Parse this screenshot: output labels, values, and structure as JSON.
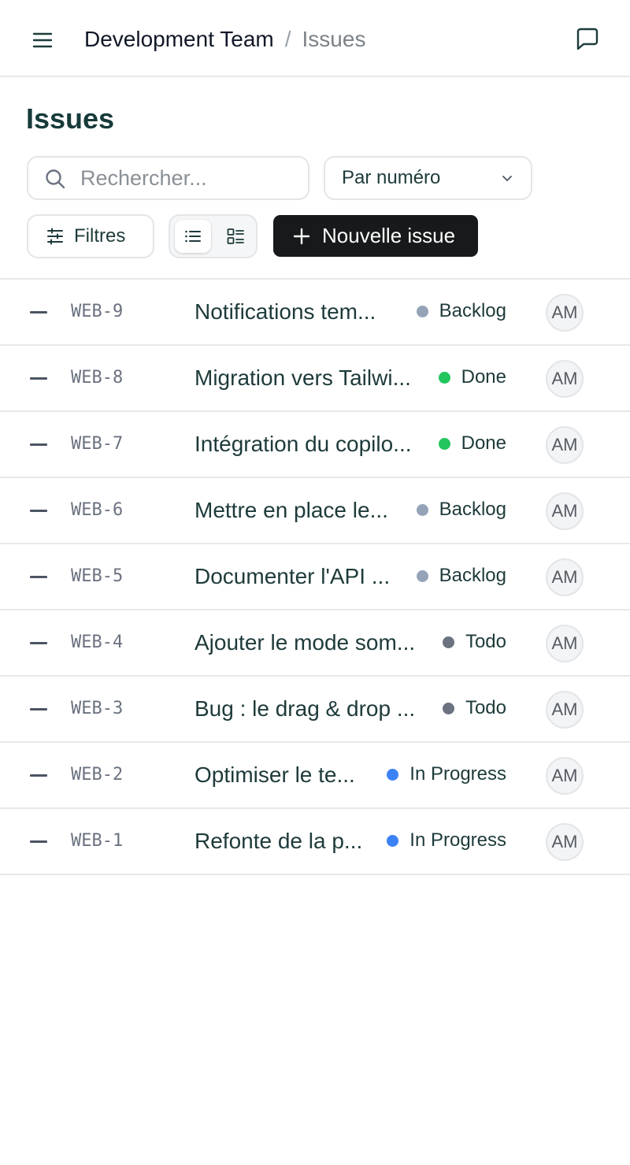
{
  "header": {
    "menu_icon": "hamburger-menu-icon",
    "team": "Development Team",
    "separator": "/",
    "current": "Issues",
    "chat_icon": "message-square-icon"
  },
  "page": {
    "title": "Issues"
  },
  "toolbar": {
    "search_placeholder": "Rechercher...",
    "sort_value": "Par numéro",
    "filters_label": "Filtres",
    "new_issue_label": "Nouvelle issue",
    "active_view": "list"
  },
  "status_colors": {
    "Backlog": "#94a3b8",
    "Done": "#22c55e",
    "Todo": "#6b7280",
    "In Progress": "#3b82f6"
  },
  "issues": [
    {
      "id": "WEB-9",
      "title": "Notifications tem...",
      "status": "Backlog",
      "assignee": "AM"
    },
    {
      "id": "WEB-8",
      "title": "Migration vers Tailwi...",
      "status": "Done",
      "assignee": "AM"
    },
    {
      "id": "WEB-7",
      "title": "Intégration du copilo...",
      "status": "Done",
      "assignee": "AM"
    },
    {
      "id": "WEB-6",
      "title": "Mettre en place le...",
      "status": "Backlog",
      "assignee": "AM"
    },
    {
      "id": "WEB-5",
      "title": "Documenter l'API ...",
      "status": "Backlog",
      "assignee": "AM"
    },
    {
      "id": "WEB-4",
      "title": "Ajouter le mode som...",
      "status": "Todo",
      "assignee": "AM"
    },
    {
      "id": "WEB-3",
      "title": "Bug : le drag & drop ...",
      "status": "Todo",
      "assignee": "AM"
    },
    {
      "id": "WEB-2",
      "title": "Optimiser le te...",
      "status": "In Progress",
      "assignee": "AM"
    },
    {
      "id": "WEB-1",
      "title": "Refonte de la p...",
      "status": "In Progress",
      "assignee": "AM"
    }
  ]
}
